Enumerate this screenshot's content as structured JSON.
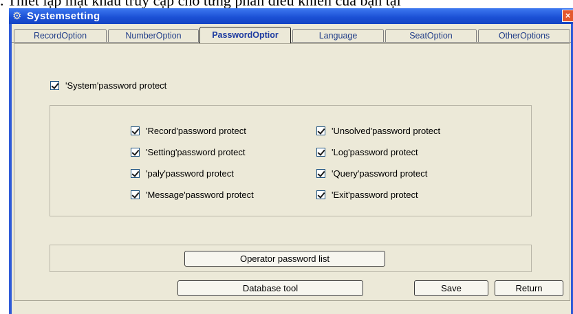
{
  "doc_text": ". Thiết lập mật khẩu truy cập cho từng phần điều khiển của bạn tại",
  "window": {
    "title": "Systemsetting",
    "close_label": "×"
  },
  "icons": {
    "title": "gears-icon",
    "close": "close-icon"
  },
  "tabs": [
    {
      "label": "RecordOption",
      "active": false
    },
    {
      "label": "NumberOption",
      "active": false
    },
    {
      "label": "PasswordOptior",
      "active": true
    },
    {
      "label": "Language",
      "active": false
    },
    {
      "label": "SeatOption",
      "active": false
    },
    {
      "label": "OtherOptions",
      "active": false
    }
  ],
  "system_protect": {
    "label": "'System'password protect",
    "checked": true
  },
  "left_options": [
    {
      "label": "'Record'password protect",
      "checked": true
    },
    {
      "label": "'Setting'password protect",
      "checked": true
    },
    {
      "label": "'paly'password protect",
      "checked": true
    },
    {
      "label": "'Message'password protect",
      "checked": true
    }
  ],
  "right_options": [
    {
      "label": "'Unsolved'password protect",
      "checked": true
    },
    {
      "label": "'Log'password protect",
      "checked": true
    },
    {
      "label": "'Query'password protect",
      "checked": true
    },
    {
      "label": "'Exit'password protect",
      "checked": true
    }
  ],
  "buttons": {
    "operator_list": "Operator password list",
    "database_tool": "Database tool",
    "save": "Save",
    "return": "Return"
  }
}
